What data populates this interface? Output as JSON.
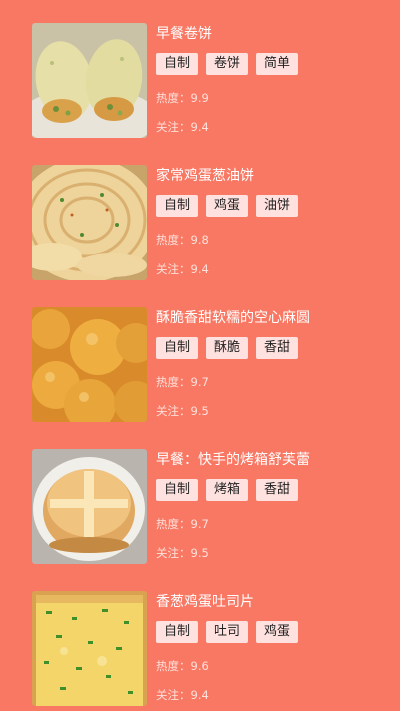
{
  "colors": {
    "background": "#F97864",
    "tag_bg": "#FFE2E0",
    "title_text": "#FFFFFF",
    "stat_text": "#FFE0DA"
  },
  "recipes": [
    {
      "title": "早餐卷饼",
      "tags": [
        "自制",
        "卷饼",
        "简单"
      ],
      "heat": "热度：9.9",
      "follow": "关注：9.4",
      "image": "breakfast-wrap-photo"
    },
    {
      "title": "家常鸡蛋葱油饼",
      "tags": [
        "自制",
        "鸡蛋",
        "油饼"
      ],
      "heat": "热度：9.8",
      "follow": "关注：9.4",
      "image": "scallion-pancake-photo"
    },
    {
      "title": "酥脆香甜软糯的空心麻圆",
      "tags": [
        "自制",
        "酥脆",
        "香甜"
      ],
      "heat": "热度：9.7",
      "follow": "关注：9.5",
      "image": "sesame-balls-photo"
    },
    {
      "title": "早餐：快手的烤箱舒芙蕾",
      "tags": [
        "自制",
        "烤箱",
        "香甜"
      ],
      "heat": "热度：9.7",
      "follow": "关注：9.5",
      "image": "souffle-bun-photo"
    },
    {
      "title": "香葱鸡蛋吐司片",
      "tags": [
        "自制",
        "吐司",
        "鸡蛋"
      ],
      "heat": "热度：9.6",
      "follow": "关注：9.4",
      "image": "egg-toast-photo"
    }
  ]
}
